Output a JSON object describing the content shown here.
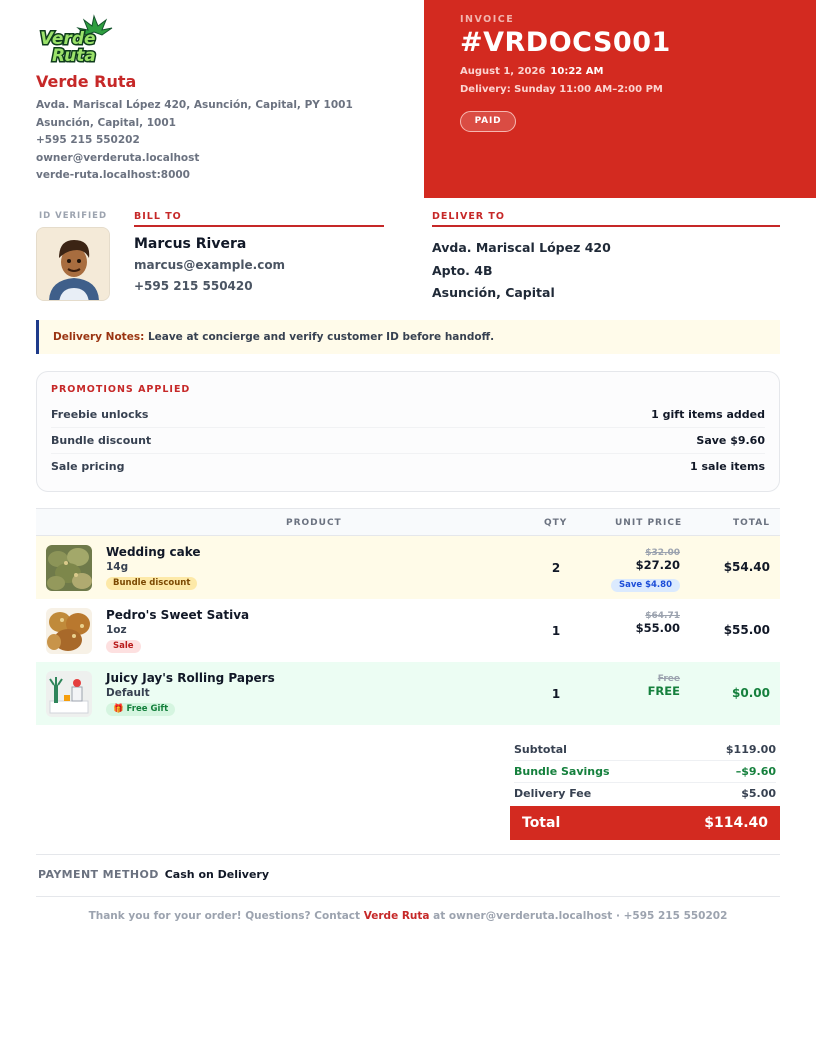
{
  "colors": {
    "accent": "#d32a20",
    "brand": "#c62828",
    "savings": "#15803d",
    "save_badge": "#1d4ed8"
  },
  "merchant": {
    "logo_text": [
      "Verde",
      "Ruta"
    ],
    "name": "Verde Ruta",
    "address_lines": [
      "Avda. Mariscal López 420, Asunción, Capital, PY 1001",
      "Asunción, Capital, 1001",
      "+595 215 550202",
      "owner@verderuta.localhost",
      "verde-ruta.localhost:8000"
    ]
  },
  "invoice": {
    "label": "INVOICE",
    "number": "#VRDOCS001",
    "date": "August 1, 2026",
    "time": "10:22 AM",
    "delivery": "Delivery: Sunday 11:00 AM–2:00 PM",
    "status": "PAID"
  },
  "customer": {
    "id_verified_label": "ID VERIFIED",
    "bill_to_label": "BILL TO",
    "name": "Marcus Rivera",
    "email": "marcus@example.com",
    "phone": "+595 215 550420",
    "deliver_to_label": "DELIVER TO",
    "deliver_lines": [
      "Avda. Mariscal López 420",
      "Apto. 4B",
      "Asunción, Capital"
    ]
  },
  "notes": {
    "label": "Delivery Notes:",
    "text": "Leave at concierge and verify customer ID before handoff."
  },
  "promotions": {
    "title": "PROMOTIONS APPLIED",
    "rows": [
      {
        "label": "Freebie unlocks",
        "value": "1 gift items added"
      },
      {
        "label": "Bundle discount",
        "value": "Save $9.60"
      },
      {
        "label": "Sale pricing",
        "value": "1 sale items"
      }
    ]
  },
  "table": {
    "headers": {
      "product": "PRODUCT",
      "qty": "QTY",
      "unit_price": "UNIT PRICE",
      "total": "TOTAL"
    },
    "items": [
      {
        "name": "Wedding cake",
        "variant": "14g",
        "tag": "Bundle discount",
        "qty": "2",
        "orig_price": "$32.00",
        "price": "$27.20",
        "save": "Save $4.80",
        "total": "$54.40",
        "icon": "flower-bud-image"
      },
      {
        "name": "Pedro's Sweet Sativa",
        "variant": "1oz",
        "tag": "Sale",
        "qty": "1",
        "orig_price": "$64.71",
        "price": "$55.00",
        "total": "$55.00",
        "icon": "flower-bud-image"
      },
      {
        "name": "Juicy Jay's Rolling Papers",
        "variant": "Default",
        "tag": "🎁 Free Gift",
        "qty": "1",
        "orig_price": "Free",
        "price": "FREE",
        "total": "$0.00",
        "icon": "rolling-papers-image"
      }
    ]
  },
  "totals": {
    "subtotal_label": "Subtotal",
    "subtotal": "$119.00",
    "savings_label": "Bundle Savings",
    "savings": "–$9.60",
    "delivery_label": "Delivery Fee",
    "delivery": "$5.00",
    "total_label": "Total",
    "total": "$114.40"
  },
  "payment": {
    "label": "PAYMENT METHOD",
    "value": "Cash on Delivery"
  },
  "footer": {
    "pre": "Thank you for your order! Questions? Contact ",
    "brand": "Verde Ruta",
    "post": " at owner@verderuta.localhost · +595 215 550202"
  }
}
